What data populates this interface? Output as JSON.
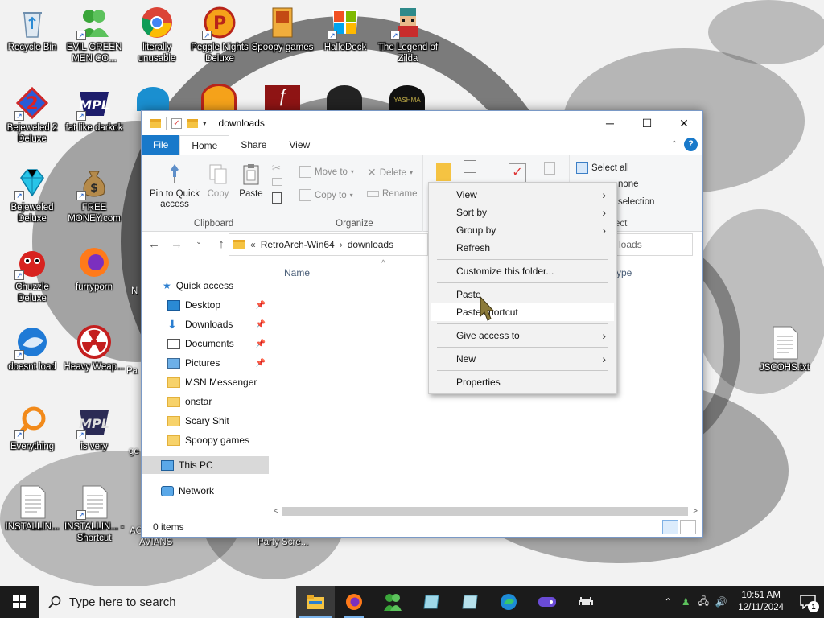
{
  "desktop": {
    "icons": [
      {
        "label": "Recycle Bin"
      },
      {
        "label": "EVIL GREEN MEN CO..."
      },
      {
        "label": "literally unusable"
      },
      {
        "label": "Peggle Nights Deluxe"
      },
      {
        "label": "Spoopy games"
      },
      {
        "label": "HalloDock"
      },
      {
        "label": "The Legend of Zilda"
      },
      {
        "label": "Bejeweled 2 Deluxe"
      },
      {
        "label": "fat like darkok"
      },
      {
        "label": "Bejeweled Deluxe"
      },
      {
        "label": "FREE MONEY.com"
      },
      {
        "label": "Chuzzle Deluxe"
      },
      {
        "label": "furryporn"
      },
      {
        "label": "doesnt load"
      },
      {
        "label": "Heavy Weap..."
      },
      {
        "label": "Everything"
      },
      {
        "label": "is very"
      },
      {
        "label": "INSTALLIN..."
      },
      {
        "label": "INSTALLIN... - Shortcut"
      },
      {
        "label": "AVIANS"
      },
      {
        "label": "Party Scre..."
      },
      {
        "label": "JSCOHS.txt"
      }
    ],
    "partial_labels": {
      "n_label": "N",
      "pa_label": "Pa",
      "ge_label": "ge",
      "ac_label": "AC",
      "yashma": "YASHMA"
    }
  },
  "explorer": {
    "title": "downloads",
    "tabs": [
      {
        "label": "File"
      },
      {
        "label": "Home"
      },
      {
        "label": "Share"
      },
      {
        "label": "View"
      }
    ],
    "ribbon": {
      "clipboard": {
        "group_label": "Clipboard",
        "pin_label": "Pin to Quick access",
        "copy_label": "Copy",
        "paste_label": "Paste"
      },
      "organize": {
        "group_label": "Organize",
        "move_to": "Move to",
        "copy_to": "Copy to",
        "delete": "Delete",
        "rename": "Rename"
      },
      "select": {
        "group_label": "ect",
        "select_all": "Select all",
        "select_none": "none",
        "invert": "selection"
      }
    },
    "address": {
      "crumbs": [
        "RetroArch-Win64",
        "downloads"
      ],
      "search_placeholder": "loads"
    },
    "nav_pane": {
      "quick_access": "Quick access",
      "items": [
        {
          "label": "Desktop",
          "pinned": true
        },
        {
          "label": "Downloads",
          "pinned": true
        },
        {
          "label": "Documents",
          "pinned": true
        },
        {
          "label": "Pictures",
          "pinned": true
        },
        {
          "label": "MSN Messenger",
          "pinned": false
        },
        {
          "label": "onstar",
          "pinned": false
        },
        {
          "label": "Scary Shit",
          "pinned": false
        },
        {
          "label": "Spoopy games",
          "pinned": false
        }
      ],
      "this_pc": "This PC",
      "network": "Network"
    },
    "columns": {
      "name": "Name",
      "type": "ype"
    },
    "status": {
      "item_count": "0 items"
    }
  },
  "context_menu": {
    "items": [
      {
        "label": "View",
        "submenu": true
      },
      {
        "label": "Sort by",
        "submenu": true
      },
      {
        "label": "Group by",
        "submenu": true
      },
      {
        "label": "Refresh",
        "submenu": false
      },
      {
        "label": "Customize this folder...",
        "submenu": false
      },
      {
        "label": "Paste",
        "submenu": false
      },
      {
        "label": "Paste shortcut",
        "submenu": false
      },
      {
        "label": "Give access to",
        "submenu": true
      },
      {
        "label": "New",
        "submenu": true
      },
      {
        "label": "Properties",
        "submenu": false
      }
    ],
    "hovered": "Paste shortcut"
  },
  "taskbar": {
    "search_placeholder": "Type here to search",
    "time": "10:51 AM",
    "date": "12/11/2024",
    "notification_count": "1",
    "apps": [
      "file-explorer",
      "firefox",
      "msn-messenger",
      "notepad-like",
      "notepad-like-2",
      "edge",
      "game-app",
      "space-invader-app"
    ]
  },
  "colors": {
    "accent": "#1979ca",
    "taskbar": "#1b1b1b",
    "menu_bg": "#f2f2f2"
  }
}
